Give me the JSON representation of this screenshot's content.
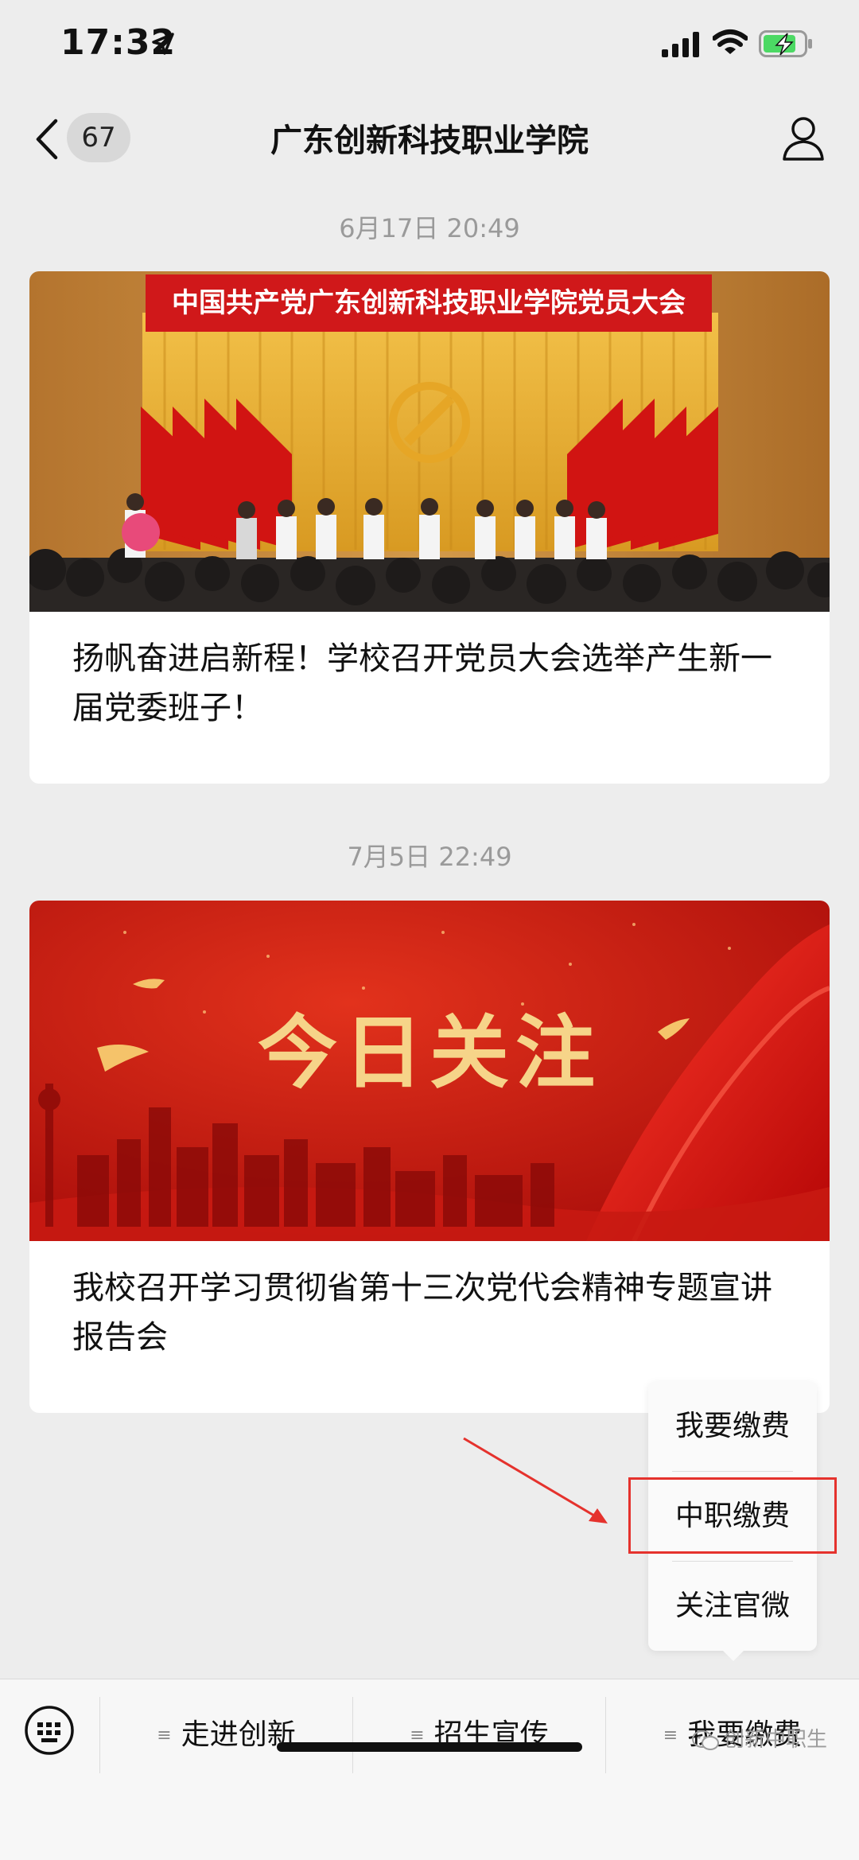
{
  "status_bar": {
    "time": "17:32"
  },
  "nav": {
    "back_count": "67",
    "title": "广东创新科技职业学院"
  },
  "messages": [
    {
      "timestamp": "6月17日 20:49",
      "banner_text": "中国共产党广东创新科技职业学院党员大会",
      "title": "扬帆奋进启新程！学校召开党员大会选举产生新一届党委班子！"
    },
    {
      "timestamp": "7月5日 22:49",
      "banner_text": "今日关注",
      "title": "我校召开学习贯彻省第十三次党代会精神专题宣讲报告会"
    }
  ],
  "popup_menu": {
    "items": [
      "我要缴费",
      "中职缴费",
      "关注官微"
    ],
    "highlighted": "中职缴费"
  },
  "bottom_menu": {
    "tabs": [
      "走进创新",
      "招生宣传",
      "我要缴费"
    ]
  },
  "watermark": "创新中职生",
  "colors": {
    "party_red": "#c8140f",
    "gold": "#f0c060",
    "annotation_red": "#e5322d",
    "background": "#ededed"
  },
  "icons": [
    "location-arrow-icon",
    "signal-icon",
    "wifi-icon",
    "battery-charging-icon",
    "back-chevron-icon",
    "profile-icon",
    "keyboard-icon",
    "menu-icon",
    "wechat-icon"
  ]
}
